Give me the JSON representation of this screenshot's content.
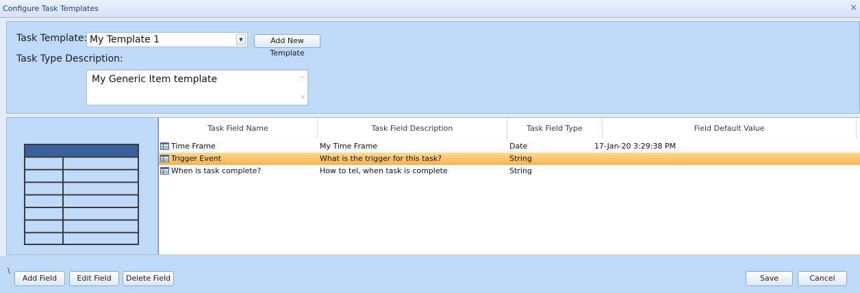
{
  "window": {
    "title": "Configure Task Templates",
    "close_glyph": "×"
  },
  "form": {
    "template_label": "Task Template:",
    "template_value": "My Template 1",
    "dropdown_glyph": "▼",
    "add_template_label": "Add New Template",
    "description_label": "Task Type Description:",
    "description_value": "My Generic Item template",
    "scroll_up_glyph": "^",
    "scroll_down_glyph": "v"
  },
  "grid": {
    "columns": [
      "Task Field Name",
      "Task Field Description",
      "Task Field Type",
      "Field Default Value"
    ],
    "rows": [
      {
        "name": "Time Frame",
        "description": "My Time Frame",
        "type": "Date",
        "default": "17-Jan-20 3:29:38 PM",
        "selected": false
      },
      {
        "name": "Trigger Event",
        "description": "What is the trigger for this task?",
        "type": "String",
        "default": "",
        "selected": true
      },
      {
        "name": "When is task complete?",
        "description": "How to tel, when task is complete",
        "type": "String",
        "default": "",
        "selected": false
      }
    ]
  },
  "footer": {
    "add_field_label": "Add Field",
    "edit_field_label": "Edit Field",
    "delete_field_label": "Delete Field",
    "save_label": "Save",
    "cancel_label": "Cancel",
    "splitter_glyph": "\\"
  },
  "colors": {
    "panel": "#bfdaf9",
    "selection": "#f7b24b",
    "preview_header": "#3b5f9a",
    "preview_cell": "#ffffff",
    "preview_border": "#3a3a3a"
  }
}
